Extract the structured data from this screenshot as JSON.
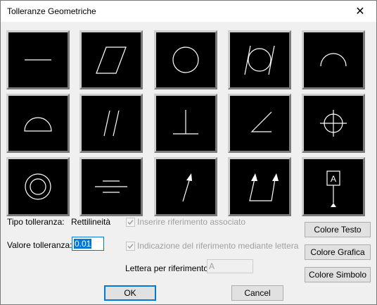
{
  "window": {
    "title": "Tolleranze Geometriche",
    "close_glyph": "✕"
  },
  "symbols": [
    "straightness-icon",
    "flatness-icon",
    "circularity-icon",
    "cylindricity-icon",
    "line-profile-icon",
    "surface-profile-icon",
    "parallelism-icon",
    "perpendicularity-icon",
    "angularity-icon",
    "position-icon",
    "concentricity-icon",
    "symmetry-icon",
    "circular-runout-icon",
    "total-runout-icon",
    "datum-target-icon"
  ],
  "datum_letter": "A",
  "form": {
    "type_label": "Tipo tolleranza:",
    "type_value": "Rettilineità",
    "value_label": "Valore tolleranza:",
    "value_input": "0.01",
    "insert_reference_label": "Inserire riferimento associato",
    "letter_reference_label": "Indicazione del riferimento mediante lettera",
    "letter_field_label": "Lettera per riferimento:",
    "letter_field_value": "A"
  },
  "buttons": {
    "text_color": "Colore Testo",
    "graphic_color": "Colore Grafica",
    "symbol_color": "Colore Simbolo",
    "ok": "OK",
    "cancel": "Cancel"
  },
  "colors": {
    "accent": "#0078d7",
    "symbol_bg": "#000000",
    "symbol_stroke": "#ffffff"
  }
}
